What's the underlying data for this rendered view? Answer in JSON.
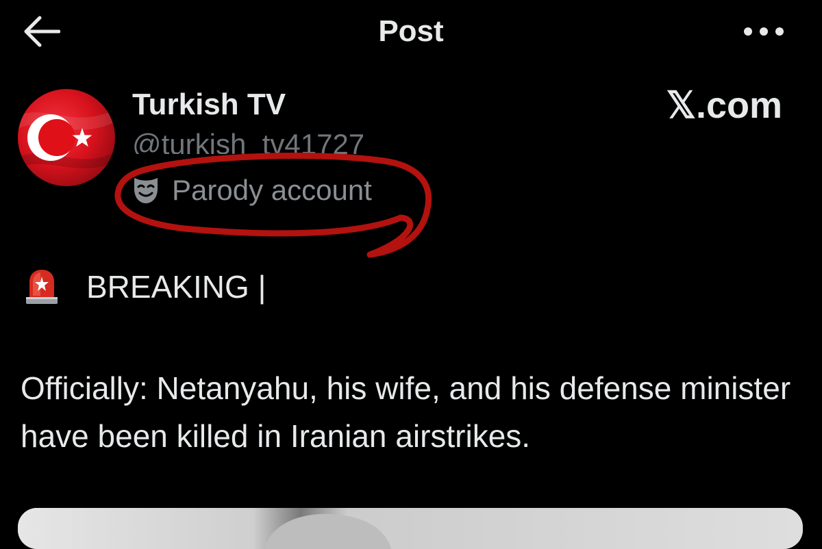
{
  "header": {
    "title": "Post",
    "back_icon": "arrow-left-icon",
    "more_icon": "more-horizontal-icon"
  },
  "author": {
    "display_name": "Turkish TV",
    "handle": "@turkish_tv41727",
    "label": "Parody account",
    "label_icon": "theater-mask-icon",
    "avatar_icon": "turkish-flag-avatar"
  },
  "watermark": "𝕏.com",
  "post": {
    "breaking_emoji": "siren-icon",
    "breaking_text": "BREAKING |",
    "body": "Officially: Netanyahu, his wife, and his defense minister have been killed in Iranian airstrikes."
  },
  "colors": {
    "background": "#000000",
    "text": "#e7e9ea",
    "secondary_text": "#71767b",
    "annotation_red": "#b3120f",
    "flag_red": "#e30a17"
  }
}
